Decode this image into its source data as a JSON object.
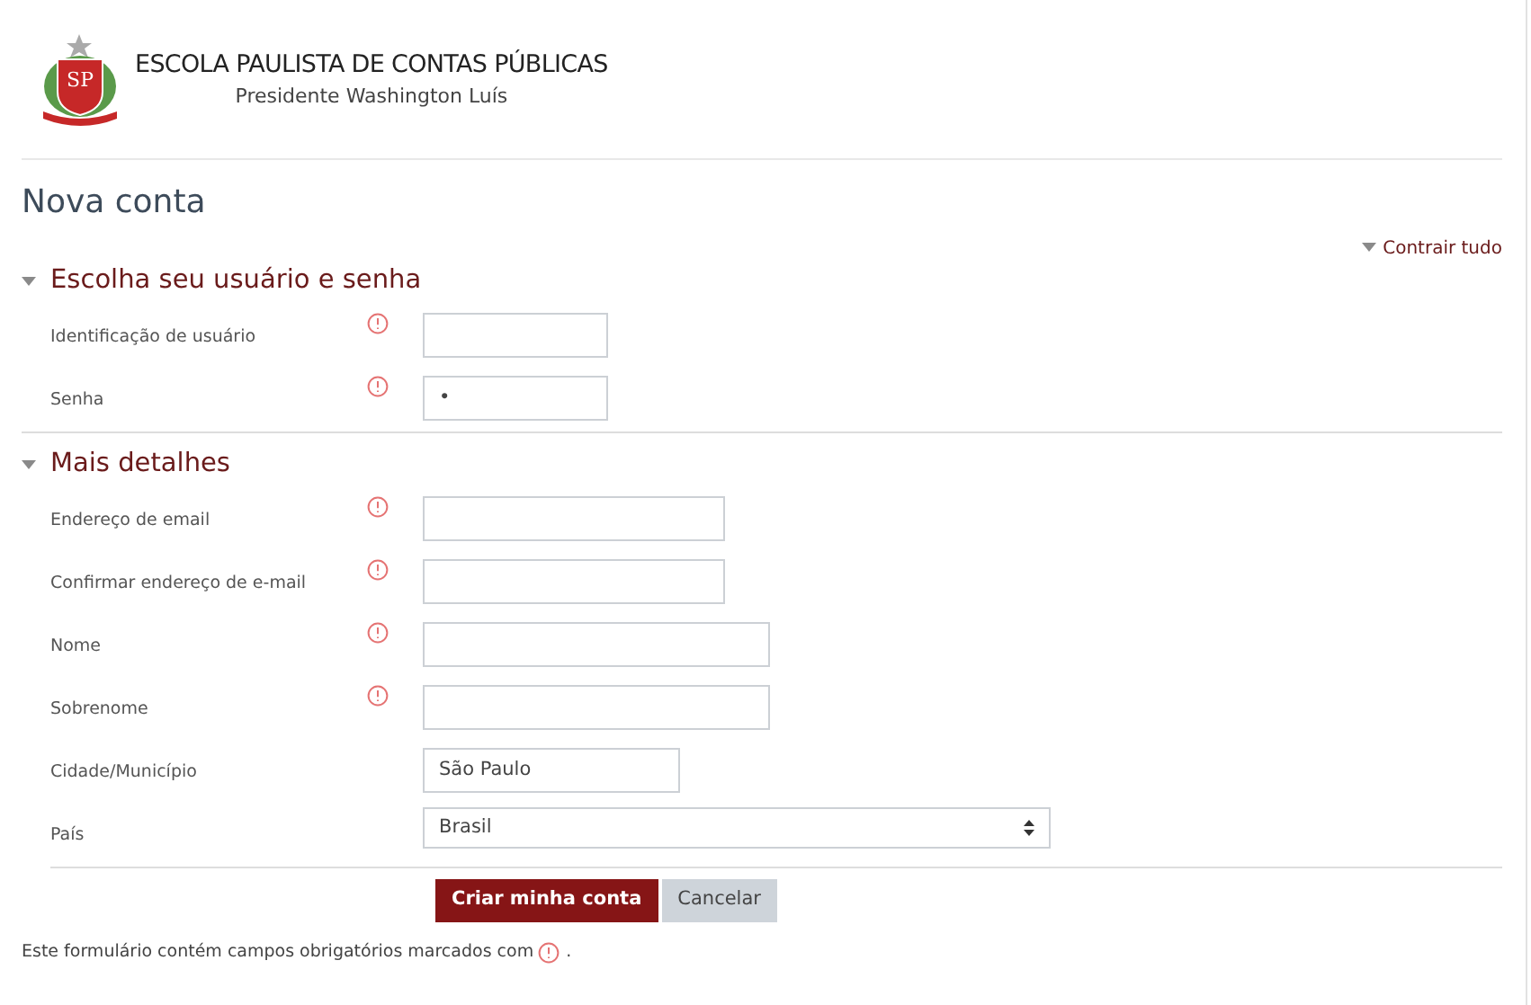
{
  "header": {
    "title": "ESCOLA PAULISTA DE CONTAS PÚBLICAS",
    "subtitle": "Presidente Washington Luís",
    "logo_text": "SP"
  },
  "page_title": "Nova conta",
  "collapse_all": "Contrair tudo",
  "sections": [
    {
      "title": "Escolha seu usuário e senha",
      "expanded": true,
      "fields": [
        {
          "kind": "text",
          "label": "Identificação de usuário",
          "required": true
        },
        {
          "kind": "text",
          "label": "Senha",
          "required": true,
          "value": "•"
        }
      ]
    },
    {
      "title": "Mais detalhes",
      "expanded": true,
      "fields": [
        {
          "kind": "text",
          "label": "Endereço de email",
          "required": true
        },
        {
          "kind": "text",
          "label": "Confirmar endereço de e-mail",
          "required": true
        },
        {
          "kind": "text",
          "label": "Nome",
          "required": true
        },
        {
          "kind": "text",
          "label": "Sobrenome",
          "required": true
        },
        {
          "kind": "text",
          "label": "Cidade/Município",
          "required": false,
          "value": "São Paulo"
        },
        {
          "kind": "select",
          "label": "País",
          "required": false,
          "value": "Brasil"
        }
      ]
    }
  ],
  "buttons": [
    {
      "label": "Criar minha conta",
      "kind": "primary"
    },
    {
      "label": "Cancelar",
      "kind": "secondary"
    }
  ],
  "footer": {
    "text": "Este formulário contém campos obrigatórios marcados com",
    "end": "."
  }
}
